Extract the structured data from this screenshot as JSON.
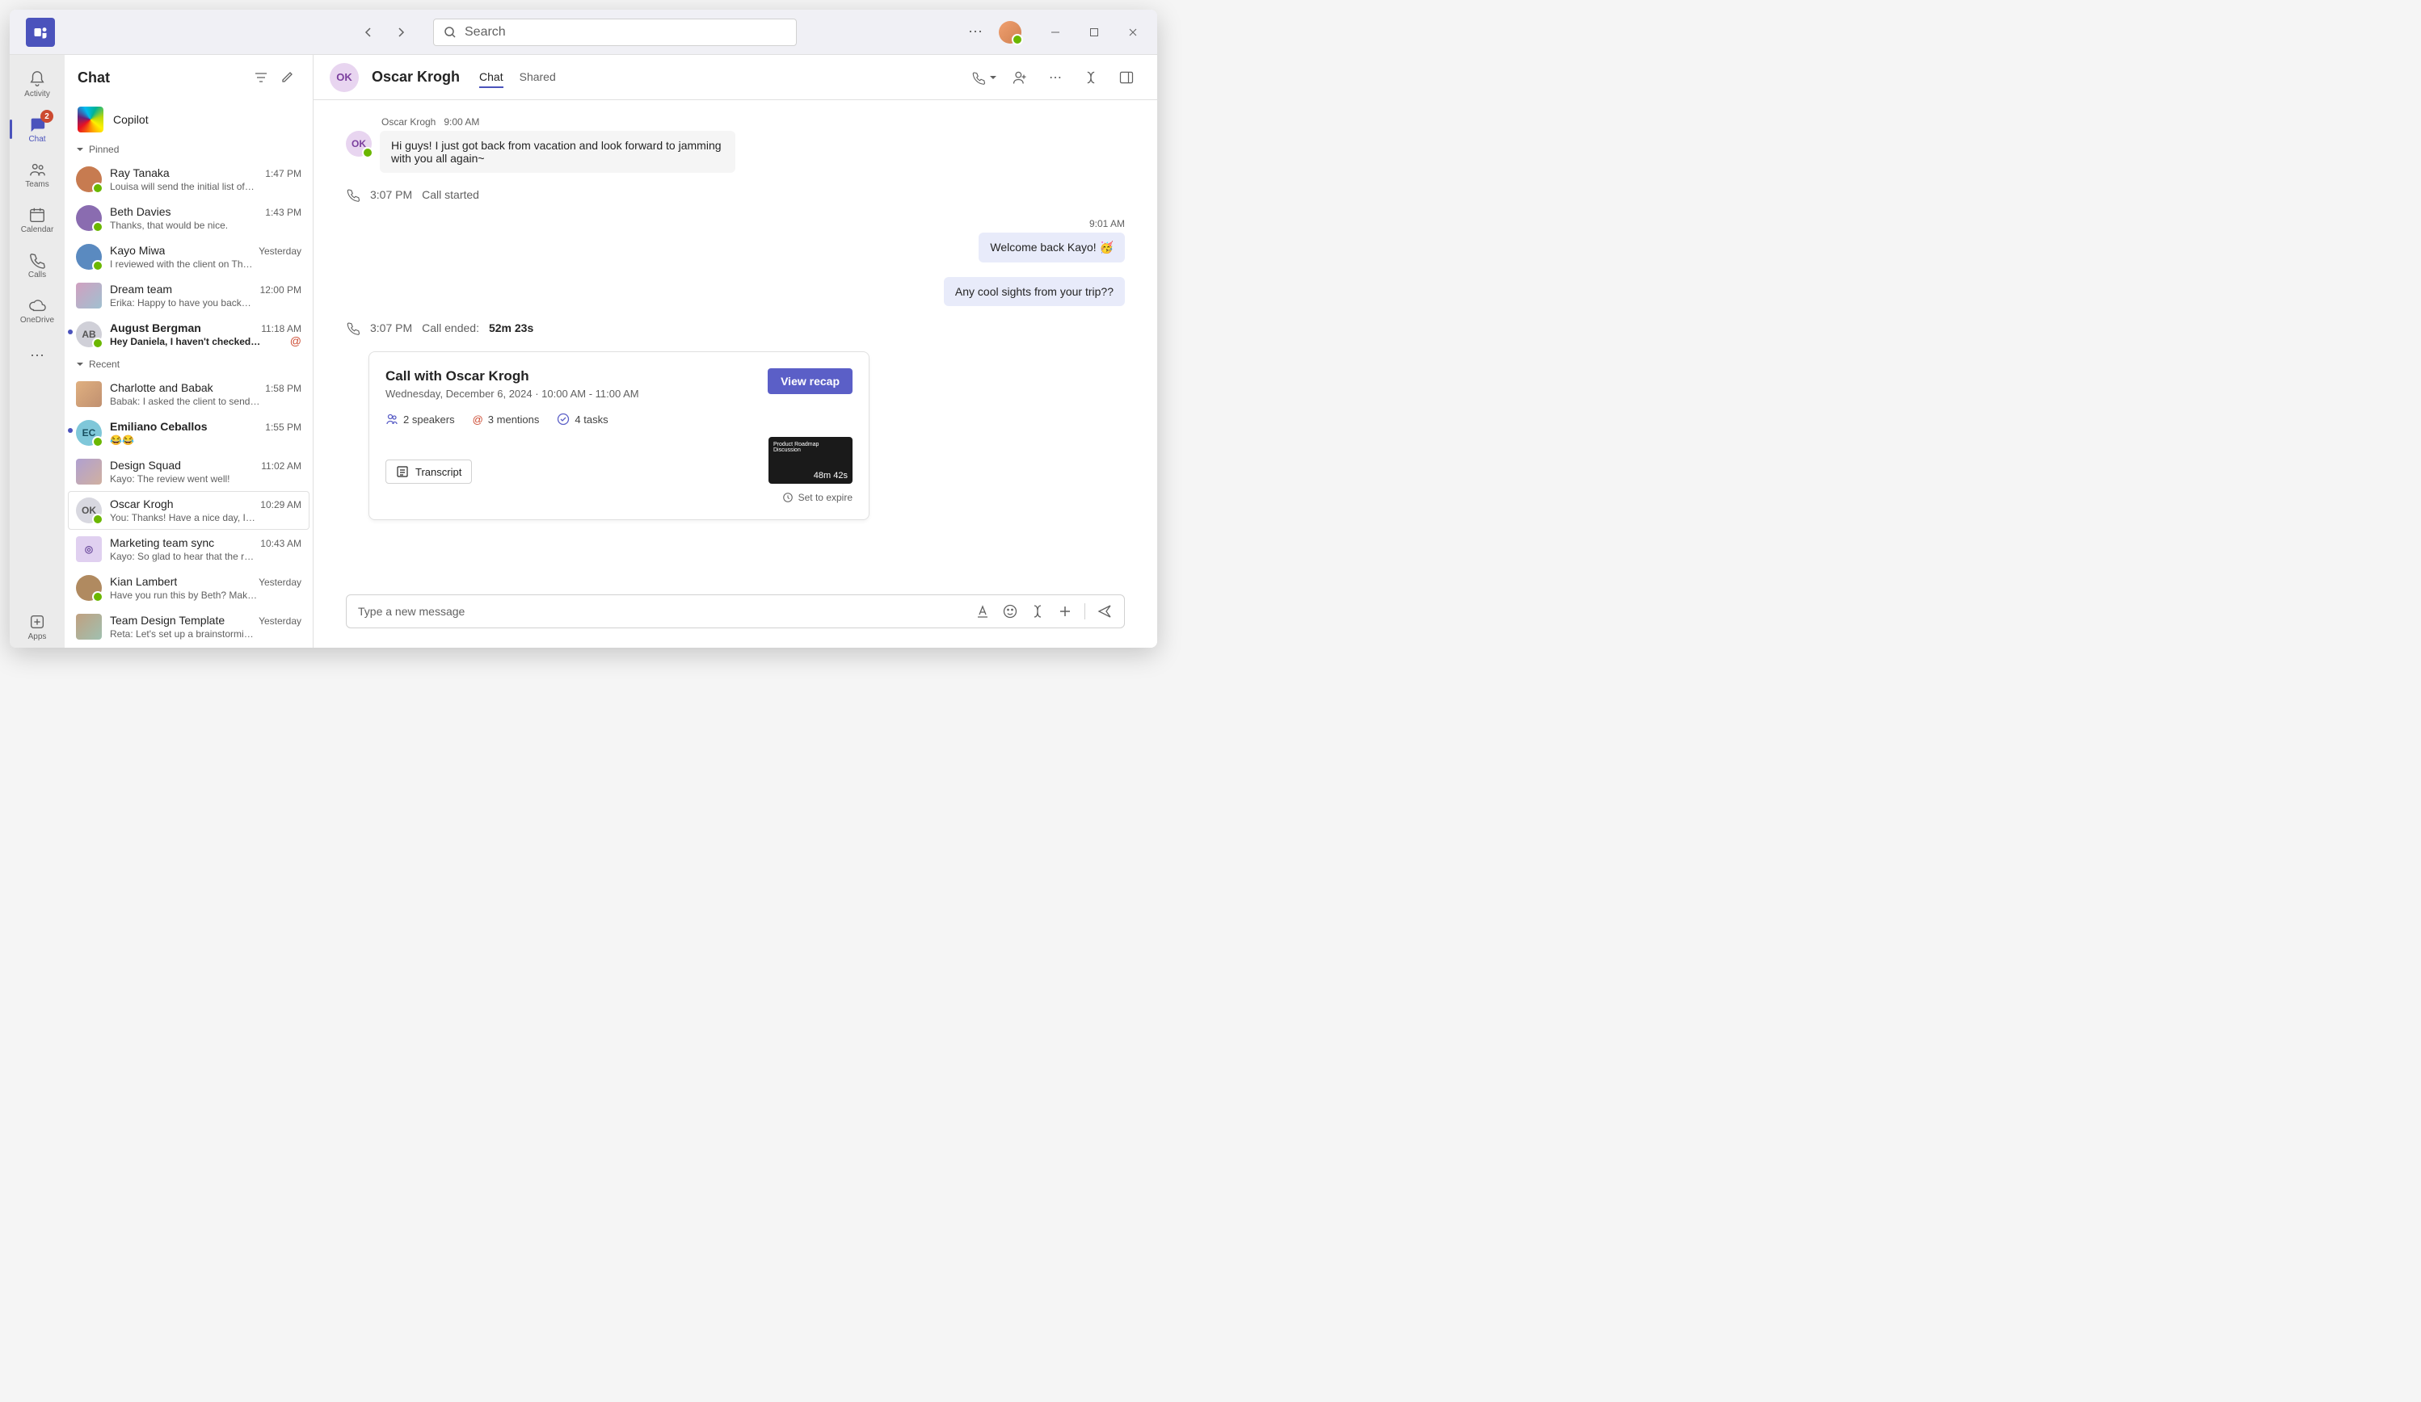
{
  "titlebar": {
    "search_placeholder": "Search"
  },
  "rail": {
    "activity": "Activity",
    "chat": "Chat",
    "chat_badge": "2",
    "teams": "Teams",
    "calendar": "Calendar",
    "calls": "Calls",
    "onedrive": "OneDrive",
    "apps": "Apps"
  },
  "chatlist": {
    "title": "Chat",
    "copilot": "Copilot",
    "section_pinned": "Pinned",
    "section_recent": "Recent",
    "pinned": [
      {
        "name": "Ray Tanaka",
        "time": "1:47 PM",
        "preview": "Louisa will send the initial list of…",
        "unread": false,
        "avatar_bg": "#c77b50"
      },
      {
        "name": "Beth Davies",
        "time": "1:43 PM",
        "preview": "Thanks, that would be nice.",
        "unread": false,
        "avatar_bg": "#8a6cb0"
      },
      {
        "name": "Kayo Miwa",
        "time": "Yesterday",
        "preview": "I reviewed with the client on Th…",
        "unread": false,
        "avatar_bg": "#5a8ac0"
      },
      {
        "name": "Dream team",
        "time": "12:00 PM",
        "preview": "Erika: Happy to have you back…",
        "unread": false,
        "group": true
      },
      {
        "name": "August Bergman",
        "time": "11:18 AM",
        "preview": "Hey Daniela, I haven't checked…",
        "unread": true,
        "initials": "AB",
        "avatar_bg": "#d0d0d8",
        "mention": true
      }
    ],
    "recent": [
      {
        "name": "Charlotte and Babak",
        "time": "1:58 PM",
        "preview": "Babak: I asked the client to send…",
        "unread": false,
        "group": true
      },
      {
        "name": "Emiliano Ceballos",
        "time": "1:55 PM",
        "preview": "😂😂",
        "unread": true,
        "initials": "EC",
        "avatar_bg": "#7fc7d9"
      },
      {
        "name": "Design Squad",
        "time": "11:02 AM",
        "preview": "Kayo: The review went well!",
        "unread": false,
        "group": true
      },
      {
        "name": "Oscar Krogh",
        "time": "10:29 AM",
        "preview": "You: Thanks! Have a nice day, I…",
        "unread": false,
        "initials": "OK",
        "avatar_bg": "#d8d8e0",
        "selected": true
      },
      {
        "name": "Marketing team sync",
        "time": "10:43 AM",
        "preview": "Kayo: So glad to hear that the r…",
        "unread": false,
        "group": true
      },
      {
        "name": "Kian Lambert",
        "time": "Yesterday",
        "preview": "Have you run this by Beth? Mak…",
        "unread": false,
        "avatar_bg": "#b08a60"
      },
      {
        "name": "Team Design Template",
        "time": "Yesterday",
        "preview": "Reta: Let's set up a brainstormi…",
        "unread": false,
        "group": true
      }
    ]
  },
  "convo": {
    "avatar_initials": "OK",
    "title": "Oscar Krogh",
    "tab_chat": "Chat",
    "tab_shared": "Shared",
    "msg_sender": "Oscar Krogh",
    "msg_time": "9:00 AM",
    "msg_in": "Hi guys! I just got back from vacation and look forward to jamming with you all again~",
    "call_start_time": "3:07 PM",
    "call_start_text": "Call started",
    "out_time": "9:01 AM",
    "msg_out1": "Welcome back Kayo! 🥳",
    "msg_out2": "Any cool sights from your trip??",
    "call_end_time": "3:07 PM",
    "call_end_text": "Call ended:",
    "call_duration": "52m 23s",
    "recap": {
      "title": "Call with Oscar Krogh",
      "subtitle": "Wednesday, December 6, 2024 · 10:00 AM - 11:00 AM",
      "button": "View recap",
      "speakers": "2 speakers",
      "mentions": "3 mentions",
      "tasks": "4 tasks",
      "transcript": "Transcript",
      "thumb_title": "Product Roadmap Discussion",
      "thumb_duration": "48m 42s",
      "expire": "Set to expire"
    },
    "composer_placeholder": "Type a new message"
  }
}
